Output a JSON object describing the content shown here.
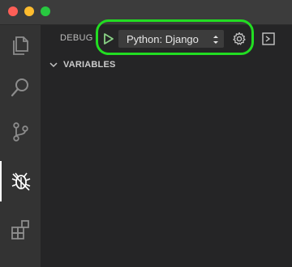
{
  "titlebar": {
    "traffic_lights": [
      "close",
      "minimize",
      "maximize"
    ]
  },
  "activity_bar": {
    "items": [
      {
        "icon": "files-icon",
        "active": false
      },
      {
        "icon": "search-icon",
        "active": false
      },
      {
        "icon": "source-control-icon",
        "active": false
      },
      {
        "icon": "debug-icon",
        "active": true
      },
      {
        "icon": "extensions-icon",
        "active": false
      }
    ]
  },
  "debug": {
    "title": "DEBUG",
    "run_icon": "play-icon",
    "configuration": "Python: Django",
    "settings_icon": "gear-icon",
    "console_icon": "debug-console-icon",
    "highlight_color": "#22dd22"
  },
  "variables_section": {
    "title": "VARIABLES",
    "expanded": true
  },
  "colors": {
    "run_green": "#89d185",
    "sidebar_bg": "#252526",
    "activity_bg": "#333333"
  }
}
